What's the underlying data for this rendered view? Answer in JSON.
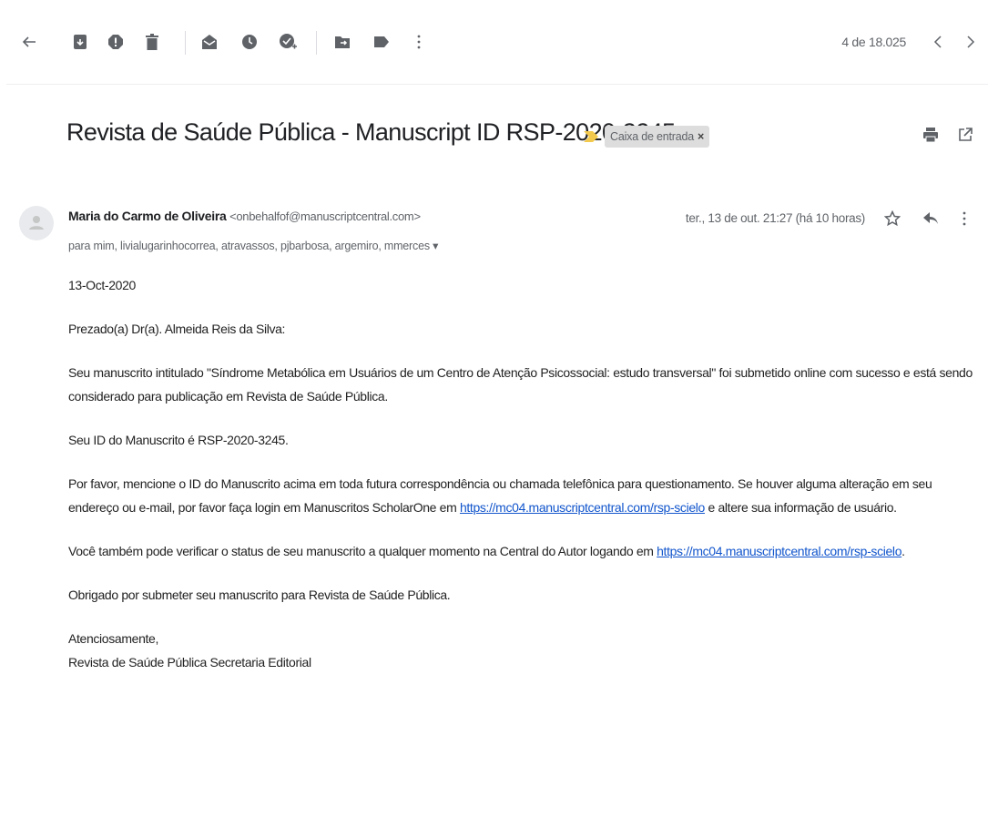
{
  "toolbar": {
    "back": "back-arrow-icon",
    "archive": "archive-icon",
    "spam": "report-spam-icon",
    "delete": "delete-icon",
    "mark_unread": "mark-unread-icon",
    "snooze": "snooze-icon",
    "add_task": "add-to-tasks-icon",
    "move": "move-to-icon",
    "labels": "label-icon",
    "more": "more-vert-icon",
    "count": "4 de 18.025"
  },
  "subject": {
    "title": "Revista de Saúde Pública - Manuscript ID RSP-2020-3245",
    "label": "Caixa de entrada",
    "label_remove": "×"
  },
  "message": {
    "sender_name": "Maria do Carmo de Oliveira",
    "sender_email": "<onbehalfof@manuscriptcentral.com>",
    "recipients": "para mim, livialugarinhocorrea, atravassos, pjbarbosa, argemiro, mmerces ▾",
    "date": "ter., 13 de out. 21:27 (há 10 horas)"
  },
  "body": {
    "date_line": "13-Oct-2020",
    "greeting": "Prezado(a) Dr(a). Almeida Reis da Silva:",
    "p1": "Seu manuscrito intitulado \"Síndrome Metabólica em Usuários de um Centro de Atenção Psicossocial: estudo transversal\" foi submetido online com sucesso e está sendo considerado para publicação em Revista de Saúde Pública.",
    "p2": "Seu ID do Manuscrito é RSP-2020-3245.",
    "p3_a": "Por favor, mencione o ID do Manuscrito acima em toda futura correspondência ou chamada telefônica para questionamento. Se houver alguma alteração em seu endereço ou e-mail, por favor faça login em Manuscritos ScholarOne em ",
    "p3_link": "https://mc04.manuscriptcentral.com/rsp-scielo",
    "p3_b": " e altere sua informação de usuário.",
    "p4_a": "Você também pode verificar o status de seu manuscrito a qualquer momento na Central do Autor logando em ",
    "p4_link": "https://mc04.manuscriptcentral.com/rsp-scielo",
    "p4_b": ".",
    "p5": "Obrigado por submeter seu manuscrito para Revista de Saúde Pública.",
    "closing": "Atenciosamente,",
    "signature": "Revista de Saúde Pública Secretaria Editorial"
  },
  "colors": {
    "link": "#1155cc",
    "important": "#f2c94c",
    "icon": "#5f6368"
  }
}
